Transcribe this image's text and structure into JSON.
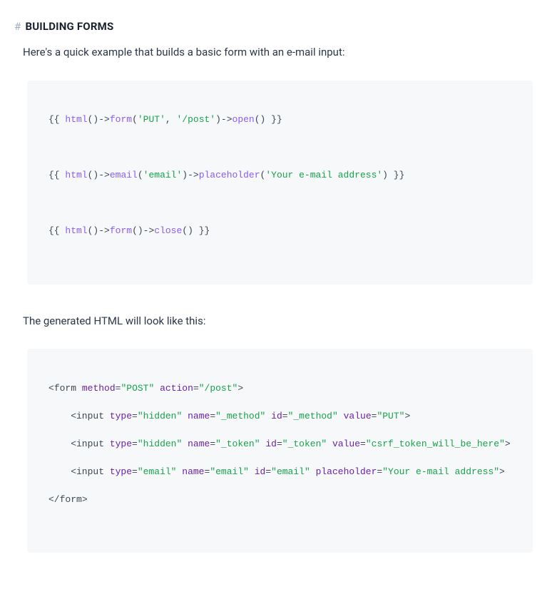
{
  "heading": {
    "hash": "#",
    "text": "BUILDING FORMS"
  },
  "intro_text": "Here's a quick example that builds a basic form with an e-mail input:",
  "code1": {
    "d1": "{{ ",
    "html_fn": "html",
    "paren": "()",
    "arrow": "->",
    "form_fn": "form",
    "open_args_l": "(",
    "put_str": "'PUT'",
    "comma": ", ",
    "post_str": "'/post'",
    "open_args_r": ")",
    "open_fn": "open",
    "empty_paren": "()",
    "d2": " }}",
    "email_fn": "email",
    "email_arg": "'email'",
    "placeholder_fn": "placeholder",
    "placeholder_arg": "'Your e-mail address'",
    "close_fn": "close"
  },
  "outro_text": "The generated HTML will look like this:",
  "code2": {
    "lt": "<",
    "gt": ">",
    "sl": "</",
    "form_tag": "form",
    "method_attr": "method",
    "method_val": "\"POST\"",
    "action_attr": "action",
    "action_val": "\"/post\"",
    "input_tag": "input",
    "type_attr": "type",
    "name_attr": "name",
    "id_attr": "id",
    "value_attr": "value",
    "placeholder_attr": "placeholder",
    "hidden_val": "\"hidden\"",
    "method_name_val": "\"_method\"",
    "put_val": "\"PUT\"",
    "token_name_val": "\"_token\"",
    "csrf_val": "\"csrf_token_will_be_here\"",
    "email_type_val": "\"email\"",
    "email_name_val": "\"email\"",
    "email_ph_val": "\"Your e-mail address\"",
    "eq": "=",
    "sp": " "
  }
}
